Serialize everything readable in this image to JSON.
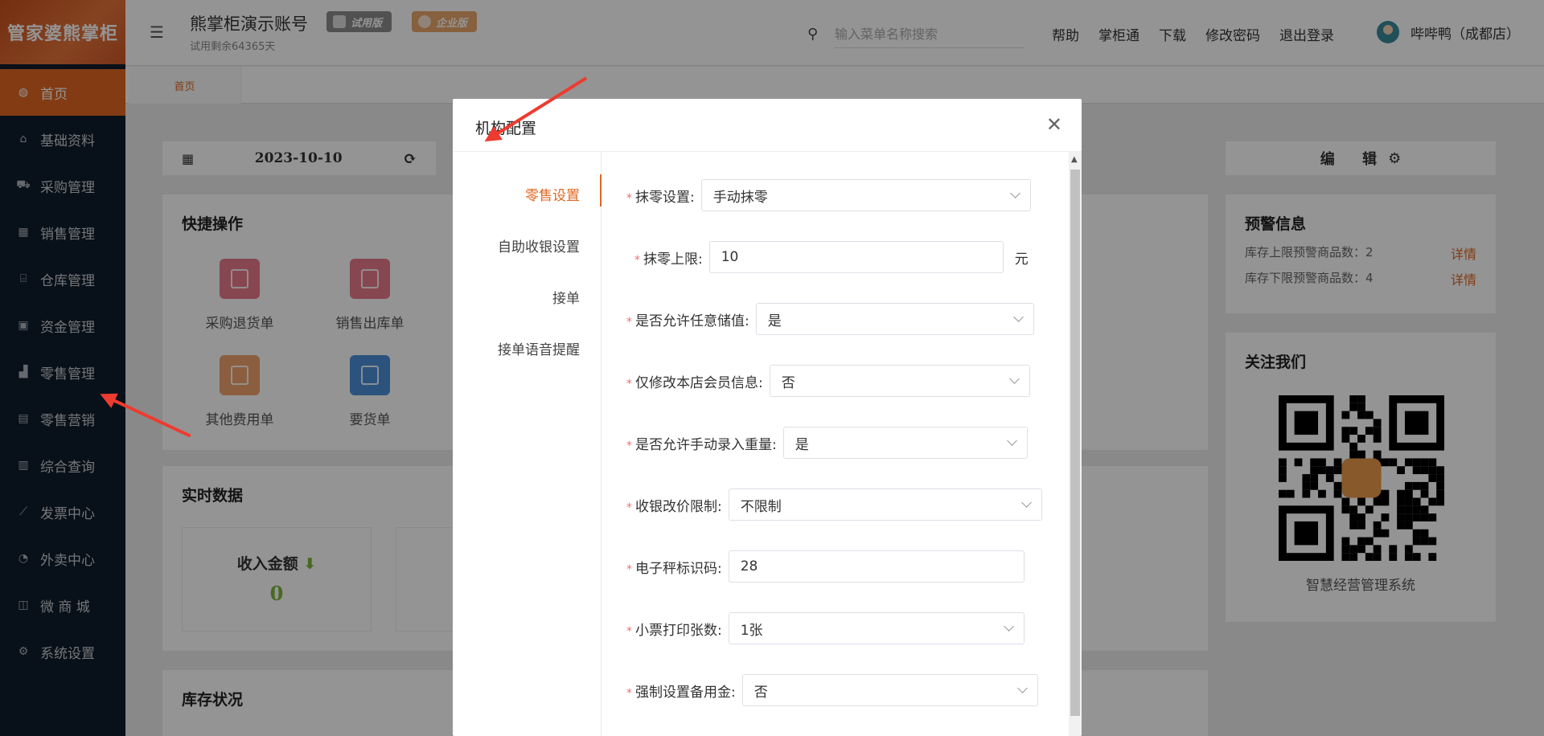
{
  "sidebar": {
    "logo": "管家婆熊掌柜",
    "items": [
      {
        "label": "首页",
        "icon": "globe-icon",
        "active": true
      },
      {
        "label": "基础资料",
        "icon": "home-icon"
      },
      {
        "label": "采购管理",
        "icon": "cart-icon"
      },
      {
        "label": "销售管理",
        "icon": "calendar-icon"
      },
      {
        "label": "仓库管理",
        "icon": "bank-icon"
      },
      {
        "label": "资金管理",
        "icon": "wallet-icon"
      },
      {
        "label": "零售管理",
        "icon": "chart-icon"
      },
      {
        "label": "零售营销",
        "icon": "gift-icon"
      },
      {
        "label": "综合查询",
        "icon": "bar-chart-icon"
      },
      {
        "label": "发票中心",
        "icon": "line-chart-icon"
      },
      {
        "label": "外卖中心",
        "icon": "bell-icon"
      },
      {
        "label": "微 商 城",
        "icon": "bag-icon"
      },
      {
        "label": "系统设置",
        "icon": "gear-icon"
      }
    ]
  },
  "header": {
    "account_title": "熊掌柜演示账号",
    "trial_badge": "试用版",
    "pro_badge": "企业版",
    "trial_remaining": "试用剩余64365天",
    "search_placeholder": "输入菜单名称搜索",
    "links": [
      "帮助",
      "掌柜通",
      "下载",
      "修改密码",
      "退出登录"
    ],
    "user_name": "哔哔鸭（成都店）"
  },
  "tabs": {
    "home": "首页"
  },
  "dashboard": {
    "date": "2023-10-10",
    "quick_title": "快捷操作",
    "quick_items": [
      {
        "label": "采购退货单",
        "color": "#e87a8a"
      },
      {
        "label": "销售出库单",
        "color": "#e87a8a"
      },
      {
        "label": "其他费用单",
        "color": "#f0a36d"
      },
      {
        "label": "要货单",
        "color": "#4a90d9"
      }
    ],
    "realtime_title": "实时数据",
    "income_label": "收入金额",
    "income_value": "0",
    "stock_title": "库存状况",
    "edit_label": "编 辑",
    "warn_title": "预警信息",
    "warn_rows": [
      {
        "label": "库存上限预警商品数：2",
        "link": "详情"
      },
      {
        "label": "库存下限预警商品数：4",
        "link": "详情"
      }
    ],
    "follow_title": "关注我们",
    "follow_caption": "智慧经营管理系统"
  },
  "modal": {
    "title": "机构配置",
    "nav": [
      {
        "label": "零售设置",
        "active": true
      },
      {
        "label": "自助收银设置"
      },
      {
        "label": "接单"
      },
      {
        "label": "接单语音提醒"
      }
    ],
    "fields": [
      {
        "label": "抹零设置:",
        "value": "手动抹零",
        "type": "select"
      },
      {
        "label": "抹零上限:",
        "value": "10",
        "type": "input",
        "unit": "元"
      },
      {
        "label": "是否允许任意储值:",
        "value": "是",
        "type": "select"
      },
      {
        "label": "仅修改本店会员信息:",
        "value": "否",
        "type": "select"
      },
      {
        "label": "是否允许手动录入重量:",
        "value": "是",
        "type": "select"
      },
      {
        "label": "收银改价限制:",
        "value": "不限制",
        "type": "select"
      },
      {
        "label": "电子秤标识码:",
        "value": "28",
        "type": "input"
      },
      {
        "label": "小票打印张数:",
        "value": "1张",
        "type": "select"
      },
      {
        "label": "强制设置备用金:",
        "value": "否",
        "type": "select"
      }
    ]
  },
  "colors": {
    "accent": "#e0661f",
    "sidebar_bg": "#0f1c2b",
    "required": "#f56c6c"
  }
}
